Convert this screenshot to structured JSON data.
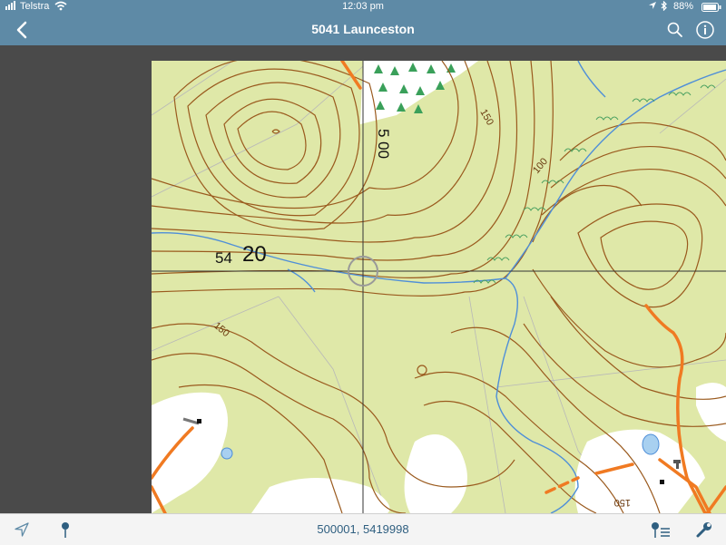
{
  "status_bar": {
    "carrier": "Telstra",
    "time": "12:03 pm",
    "battery": "88%"
  },
  "nav": {
    "title": "5041 Launceston",
    "back_icon": "chevron-left-icon",
    "search_icon": "search-icon",
    "info_icon": "info-icon"
  },
  "map": {
    "grid_label_vertical": "5 00",
    "grid_label_horizontal_small": "54",
    "grid_label_horizontal_large": "20",
    "contour_labels": [
      "150",
      "100",
      "150",
      "150"
    ]
  },
  "bottom_bar": {
    "coordinates": "500001, 5419998",
    "left_icons": [
      "location-arrow-icon",
      "pin-icon"
    ],
    "right_icons": [
      "pin-list-icon",
      "wrench-icon"
    ]
  },
  "colors": {
    "bar_blue": "#5e8aa6",
    "map_green": "#dfe8a8",
    "contour": "#9a5a1e",
    "water": "#4f8fd8",
    "road": "#f07a22"
  }
}
